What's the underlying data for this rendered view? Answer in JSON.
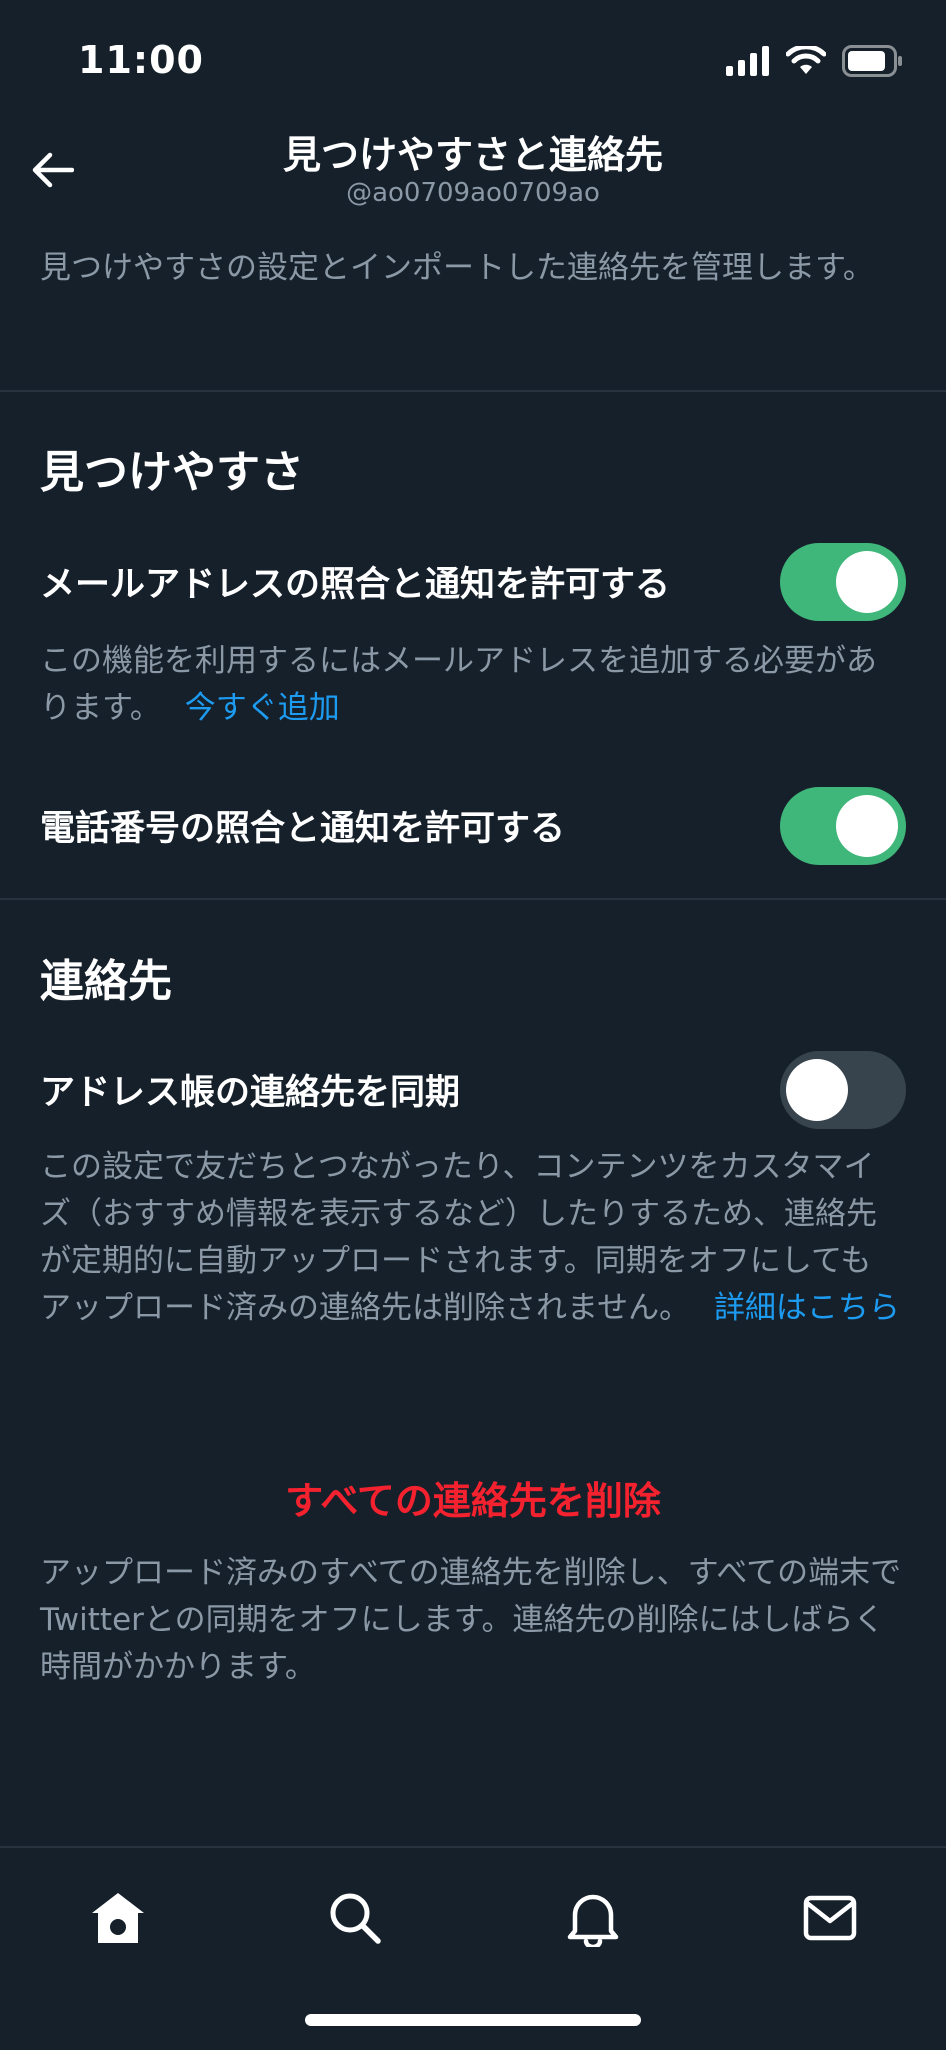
{
  "status": {
    "time": "11:00"
  },
  "header": {
    "title": "見つけやすさと連絡先",
    "username": "@ao0709ao0709ao"
  },
  "intro": "見つけやすさの設定とインポートした連絡先を管理します。",
  "discoverability": {
    "title": "見つけやすさ",
    "email_label": "メールアドレスの照合と通知を許可する",
    "email_on": true,
    "email_desc": "この機能を利用するにはメールアドレスを追加する必要があります。",
    "email_link": "今すぐ追加",
    "phone_label": "電話番号の照合と通知を許可する",
    "phone_on": true
  },
  "contacts": {
    "title": "連絡先",
    "sync_label": "アドレス帳の連絡先を同期",
    "sync_on": false,
    "sync_desc": "この設定で友だちとつながったり、コンテンツをカスタマイズ（おすすめ情報を表示するなど）したりするため、連絡先が定期的に自動アップロードされます。同期をオフにしてもアップロード済みの連絡先は削除されません。",
    "sync_link": "詳細はこちら",
    "delete_label": "すべての連絡先を削除",
    "delete_desc": "アップロード済みのすべての連絡先を削除し、すべての端末でTwitterとの同期をオフにします。連絡先の削除にはしばらく時間がかかります。"
  },
  "icons": {
    "back": "back-arrow-icon",
    "home": "home-icon",
    "search": "search-icon",
    "notifications": "bell-icon",
    "messages": "mail-icon"
  },
  "colors": {
    "background": "#15202b",
    "toggle_on": "#3fb77a",
    "link": "#1d9bf0",
    "danger": "#f4212e",
    "secondary_text": "#8b98a5"
  }
}
